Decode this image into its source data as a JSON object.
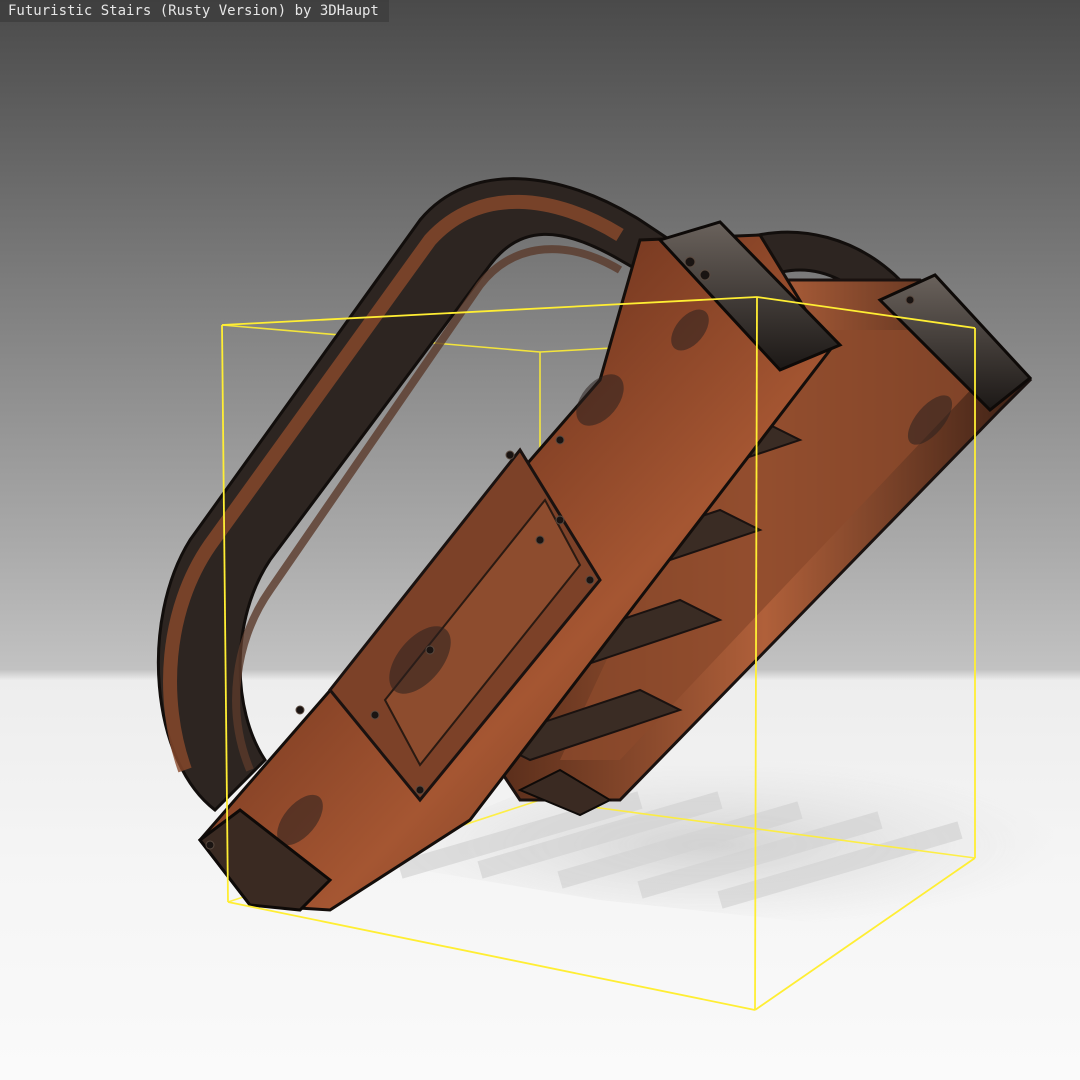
{
  "viewer": {
    "title": "Futuristic Stairs (Rusty Version) by 3DHaupt"
  },
  "colors": {
    "bounding_box": "#ffee33",
    "rust": "#9a4a2a",
    "metal_dark": "#2a2522"
  }
}
